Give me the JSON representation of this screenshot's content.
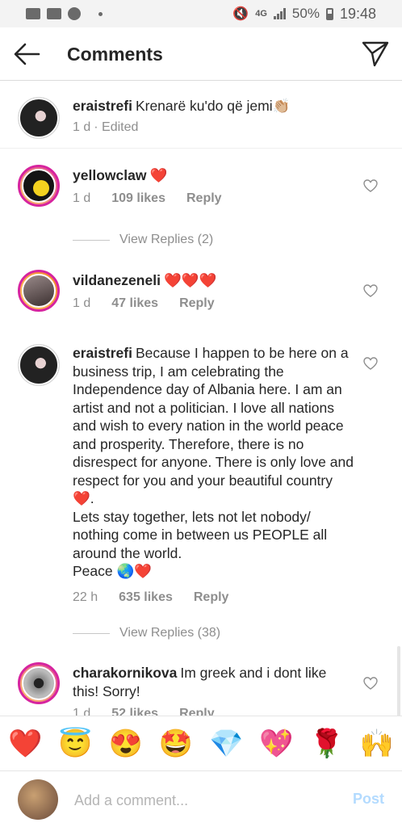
{
  "status_bar": {
    "network": "4G",
    "battery": "50%",
    "time": "19:48"
  },
  "header": {
    "title": "Comments",
    "back_icon": "arrow-left-icon",
    "send_icon": "paper-plane-icon"
  },
  "caption": {
    "username": "eraistrefi",
    "text": "Krenarë ku'do që jemi👏🏼",
    "time": "1 d",
    "edited": "· Edited"
  },
  "comments": [
    {
      "username": "yellowclaw",
      "text": "❤️",
      "time": "1 d",
      "likes": "109 likes",
      "reply": "Reply",
      "view_replies": "View Replies (2)"
    },
    {
      "username": "vildanezeneli",
      "text": "❤️❤️❤️",
      "time": "1 d",
      "likes": "47 likes",
      "reply": "Reply"
    },
    {
      "username": "eraistrefi",
      "text": "Because I happen to be here on a business trip, I am celebrating the Independence day of Albania here. I am an artist and not a politician. I love all nations and wish to every nation in the world peace and prosperity. Therefore, there is no disrespect for anyone. There is only love and respect for you and your beautiful country❤️.\nLets stay together, lets not let nobody/ nothing come in between us PEOPLE all around the world.\nPeace 🌏❤️",
      "time": "22 h",
      "likes": "635 likes",
      "reply": "Reply",
      "view_replies": "View Replies (38)"
    },
    {
      "username": "charakornikova",
      "text": "Im greek and i dont like this! Sorry!",
      "time": "1 d",
      "likes": "52 likes",
      "reply": "Reply"
    }
  ],
  "reactions": [
    "❤️",
    "😇",
    "😍",
    "🤩",
    "💎",
    "💖",
    "🌹",
    "🙌"
  ],
  "input": {
    "placeholder": "Add a comment...",
    "post_label": "Post"
  },
  "colors": {
    "accent": "#0095f6",
    "post_disabled": "#b3dbff",
    "muted": "#8e8e8e",
    "heart_red": "#ed4956"
  }
}
